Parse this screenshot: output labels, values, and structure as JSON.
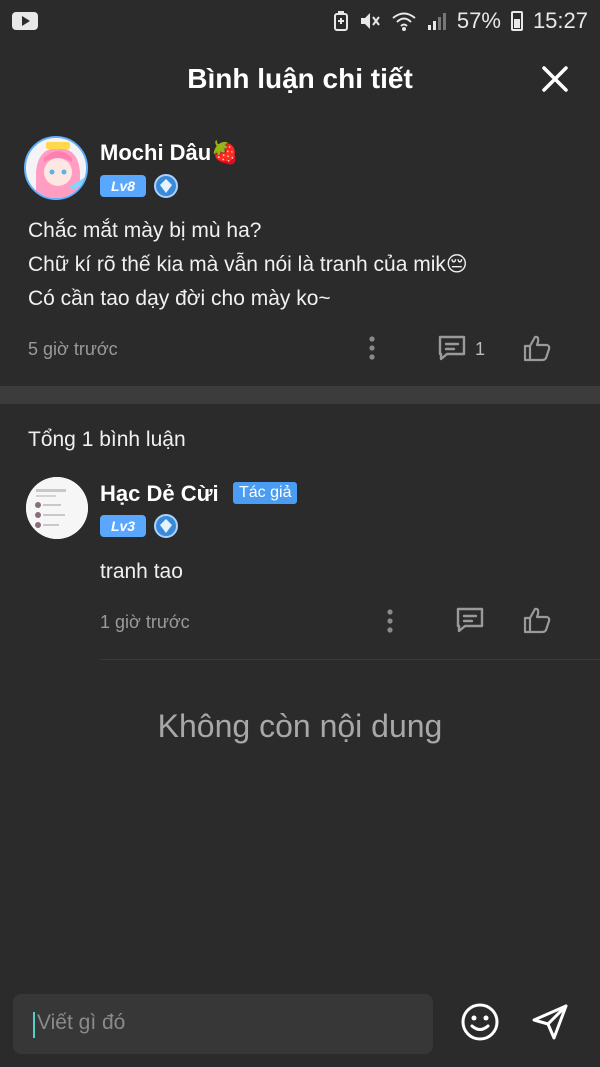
{
  "status_bar": {
    "battery": "57%",
    "time": "15:27"
  },
  "header": {
    "title": "Bình luận chi tiết"
  },
  "post": {
    "username": "Mochi Dâu🍓",
    "level": "Lv8",
    "body_lines": [
      "Chắc mắt mày bị mù ha?",
      "Chữ kí rõ thế kia mà vẫn nói là tranh của mik😔",
      "Có cần tao dạy đời cho mày ko~"
    ],
    "time": "5 giờ trước",
    "reply_count": "1"
  },
  "comments": {
    "total_label": "Tổng 1 bình luận",
    "items": [
      {
        "username": "Hạc Dẻ Cừi",
        "author_tag": "Tác giả",
        "level": "Lv3",
        "text": "tranh tao",
        "time": "1 giờ trước"
      }
    ],
    "empty_message": "Không còn nội dung"
  },
  "composer": {
    "placeholder": "Viết gì đó"
  },
  "colors": {
    "background": "#2b2b2b",
    "accent": "#5aa7ff",
    "author_tag": "#4a9df2",
    "divider": "#3c3c3c"
  }
}
